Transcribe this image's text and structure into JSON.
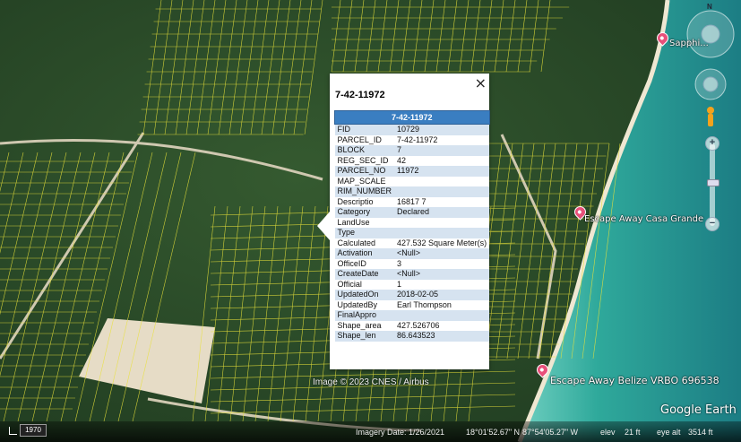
{
  "map": {
    "attribution": "Image © 2023 CNES / Airbus",
    "places": [
      {
        "name": "Sapphire",
        "label": "Sapphi..."
      },
      {
        "name": "Escape Away Casa Grande",
        "label": "Escape Away Casa Grande"
      },
      {
        "name": "Escape Away Belize VRBO 696538",
        "label": "Escape Away Belize VRBO 696538"
      }
    ],
    "compass_label": "N"
  },
  "popup": {
    "title": "7-42-11972",
    "table_header": "7-42-11972",
    "close_icon": "×",
    "attributes": [
      {
        "key": "FID",
        "value": "10729"
      },
      {
        "key": "PARCEL_ID",
        "value": "7-42-11972"
      },
      {
        "key": "BLOCK",
        "value": "7"
      },
      {
        "key": "REG_SEC_ID",
        "value": "42"
      },
      {
        "key": "PARCEL_NO",
        "value": "11972"
      },
      {
        "key": "MAP_SCALE",
        "value": ""
      },
      {
        "key": "RIM_NUMBER",
        "value": ""
      },
      {
        "key": "Descriptio",
        "value": "16817 7"
      },
      {
        "key": "Category",
        "value": "Declared"
      },
      {
        "key": "LandUse",
        "value": ""
      },
      {
        "key": "Type",
        "value": ""
      },
      {
        "key": "Calculated",
        "value": "427.532 Square Meter(s)"
      },
      {
        "key": "Activation",
        "value": "<Null>"
      },
      {
        "key": "OfficeID",
        "value": "3"
      },
      {
        "key": "CreateDate",
        "value": "<Null>"
      },
      {
        "key": "Official",
        "value": "1"
      },
      {
        "key": "UpdatedOn",
        "value": "2018-02-05"
      },
      {
        "key": "UpdatedBy",
        "value": "Earl Thompson"
      },
      {
        "key": "FinalAppro",
        "value": ""
      },
      {
        "key": "Shape_area",
        "value": "427.526706"
      },
      {
        "key": "Shape_len",
        "value": "86.643523"
      }
    ]
  },
  "statusbar": {
    "year": "1970",
    "imagery_date": "Imagery Date: 1/26/2021",
    "latitude": "18°01'52.67\" N",
    "longitude": "87°54'05.27\" W",
    "elev_label": "elev",
    "elev_value": "21 ft",
    "eye_alt_label": "eye alt",
    "eye_alt_value": "3514 ft"
  },
  "logo": "Google Earth",
  "colors": {
    "vegetation": "#2c4a2a",
    "sea": "#2ea69a",
    "sand": "#e6dcc6",
    "parcel_lines": "#e9e23a",
    "popup_header": "#3a7ec1",
    "row_alt": "#d6e3f0",
    "pin": "#e8507a"
  },
  "zoom": {
    "plus": "+",
    "minus": "−"
  }
}
